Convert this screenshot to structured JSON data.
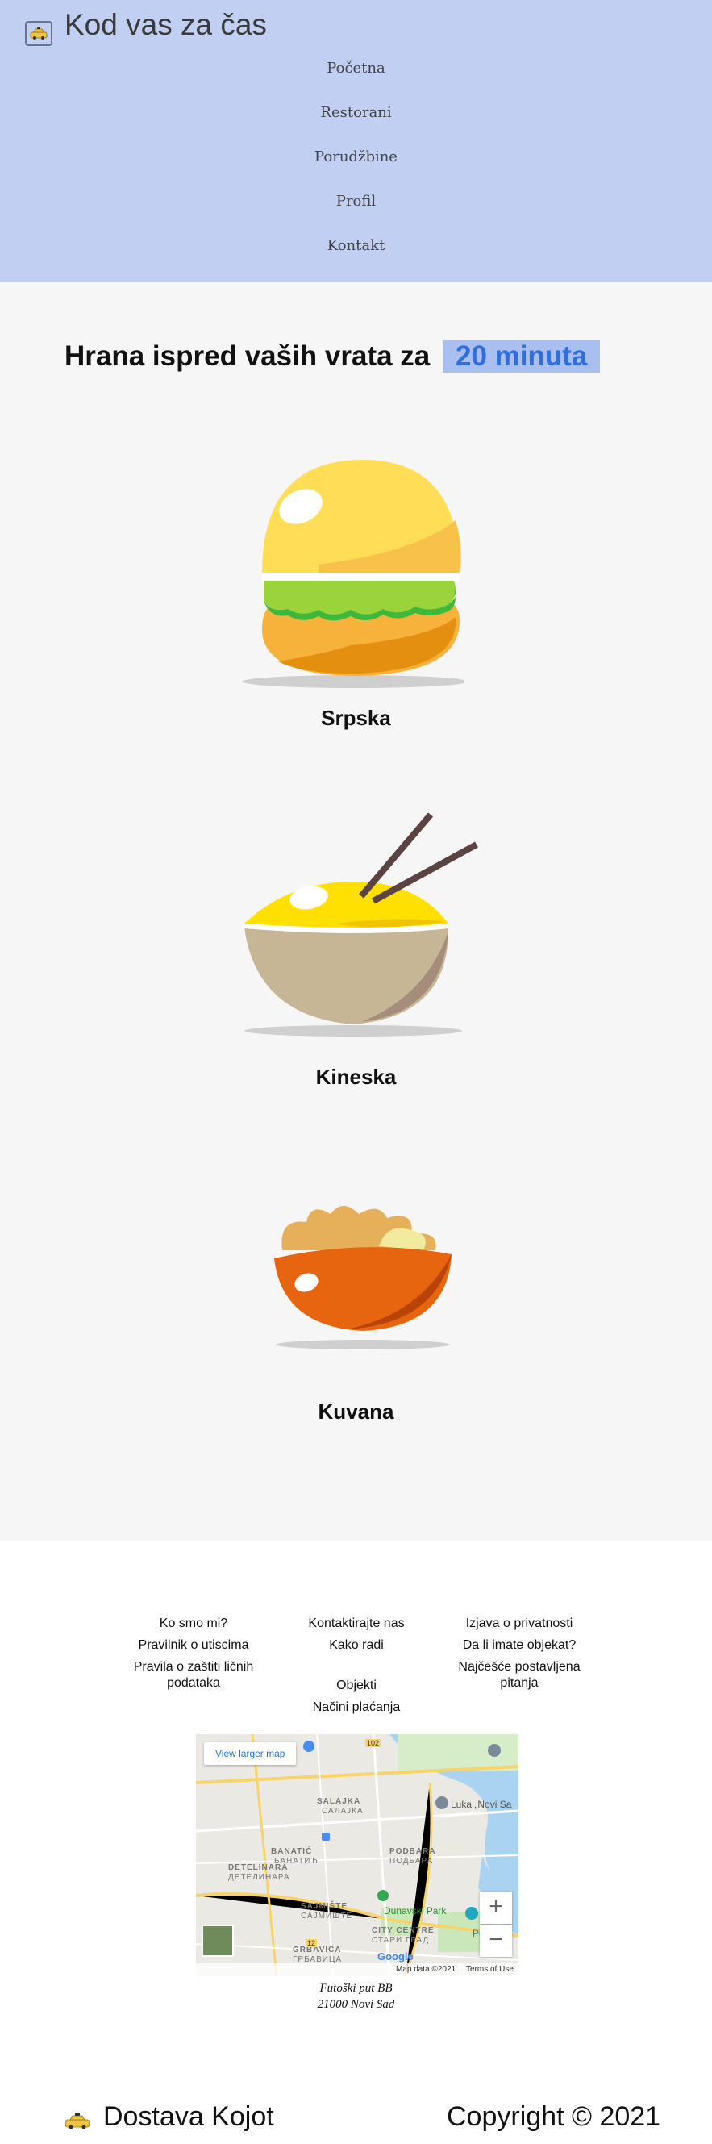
{
  "header": {
    "title": "Kod vas za čas",
    "logo_icon": "taxi-icon",
    "nav": [
      "Početna",
      "Restorani",
      "Porudžbine",
      "Profil",
      "Kontakt"
    ]
  },
  "hero": {
    "headline_prefix": "Hrana ispred vaših vrata za",
    "headline_highlight": "20 minuta",
    "highlight_bg": "#a9bff0",
    "highlight_color": "#2f6ee0"
  },
  "dishes": [
    {
      "label": "Srpska",
      "icon": "burger-icon"
    },
    {
      "label": "Kineska",
      "icon": "noodle-bowl-icon"
    },
    {
      "label": "Kuvana",
      "icon": "soup-bowl-icon"
    }
  ],
  "footer": {
    "col1": [
      "Ko smo mi?",
      "Pravilnik o utiscima",
      "Pravila o zaštiti ličnih podataka"
    ],
    "col2": [
      "Kontaktirajte nas",
      "Kako radi",
      "Objekti",
      "Načini plaćanja"
    ],
    "col3": [
      "Izjava o privatnosti",
      "Da li imate objekat?",
      "Najčešće postavljena pitanja"
    ],
    "map": {
      "button": "View larger map",
      "zoom_in": "+",
      "zoom_out": "−",
      "attribution": "Map data ©2021",
      "terms": "Terms of Use",
      "google": "Google",
      "labels": [
        "SALAJKA",
        "САЛАЈКА",
        "BANATIĆ",
        "БАНАТИЋ",
        "PODBARA",
        "ПОДБАРА",
        "DETELINARA",
        "ДЕТЕЛИНАРА",
        "SAJMIŠTE",
        "САЈМИШТЕ",
        "CITY CENTRE",
        "СТАРИ ГРАД",
        "GRBAVICA",
        "ГРБАВИЦА",
        "Dunavski Park",
        "Luka „Novi Sa",
        "Petro",
        "102",
        "12"
      ]
    },
    "address_line1": "Futoški put BB",
    "address_line2": "21000 Novi Sad",
    "brand": "Dostava Kojot",
    "copyright": "Copyright © 2021"
  }
}
